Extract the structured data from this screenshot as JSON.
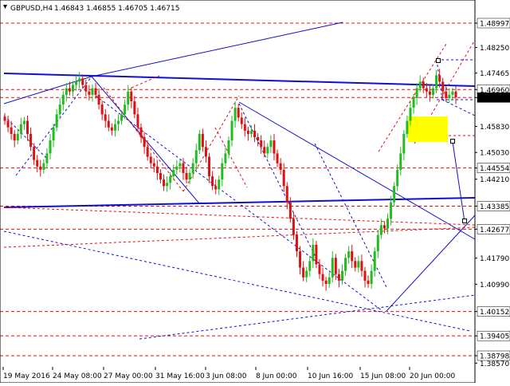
{
  "header": {
    "symbol": "GBPUSD,H4",
    "ohlc": "1.46843 1.46855 1.46705 1.46715"
  },
  "colors": {
    "background": "#ffffff",
    "bull": "#22bb22",
    "bear": "#dd1111",
    "red_line": "#e01010",
    "blue_line": "#1010cc",
    "highlight": "#ffff00"
  },
  "chart_data": {
    "type": "candlestick",
    "ylim": [
      1.3857,
      1.5023
    ],
    "y_ticks": [
      "1.48997",
      "1.48250",
      "1.47465",
      "1.46960",
      "1.46715",
      "1.45830",
      "1.45030",
      "1.44210",
      "1.44554",
      "1.43385",
      "1.42677",
      "1.41790",
      "1.40990",
      "1.40152",
      "1.39405",
      "1.38798",
      "1.38570"
    ],
    "x_ticks": [
      "19 May 2016",
      "24 May 08:00",
      "27 May 00:00",
      "31 May 16:00",
      "3 Jun 08:00",
      "8 Jun 00:00",
      "10 Jun 16:00",
      "15 Jun 08:00",
      "20 Jun 00:00"
    ],
    "marked_levels": [
      "1.48997",
      "1.46960",
      "1.46715",
      "1.44554",
      "1.43385",
      "1.42677",
      "1.40152",
      "1.39405",
      "1.38798"
    ],
    "close_series": [
      1.46,
      1.458,
      1.456,
      1.454,
      1.456,
      1.459,
      1.46,
      1.456,
      1.452,
      1.448,
      1.446,
      1.445,
      1.447,
      1.45,
      1.454,
      1.458,
      1.462,
      1.465,
      1.468,
      1.47,
      1.469,
      1.471,
      1.472,
      1.473,
      1.471,
      1.469,
      1.468,
      1.47,
      1.468,
      1.465,
      1.462,
      1.46,
      1.458,
      1.457,
      1.459,
      1.46,
      1.462,
      1.465,
      1.469,
      1.466,
      1.462,
      1.458,
      1.455,
      1.452,
      1.449,
      1.447,
      1.446,
      1.444,
      1.442,
      1.44,
      1.441,
      1.443,
      1.445,
      1.446,
      1.447,
      1.444,
      1.442,
      1.444,
      1.447,
      1.451,
      1.456,
      1.452,
      1.449,
      1.443,
      1.44,
      1.439,
      1.442,
      1.447,
      1.45,
      1.454,
      1.46,
      1.464,
      1.461,
      1.459,
      1.457,
      1.456,
      1.457,
      1.455,
      1.454,
      1.452,
      1.45,
      1.452,
      1.454,
      1.45,
      1.447,
      1.445,
      1.44,
      1.435,
      1.43,
      1.425,
      1.42,
      1.415,
      1.412,
      1.414,
      1.417,
      1.422,
      1.416,
      1.413,
      1.411,
      1.41,
      1.412,
      1.418,
      1.413,
      1.411,
      1.414,
      1.418,
      1.42,
      1.417,
      1.415,
      1.417,
      1.414,
      1.411,
      1.41,
      1.414,
      1.42,
      1.425,
      1.428,
      1.427,
      1.43,
      1.435,
      1.44,
      1.445,
      1.45,
      1.456,
      1.46,
      1.464,
      1.467,
      1.47,
      1.472,
      1.47,
      1.469,
      1.468,
      1.47,
      1.474,
      1.472,
      1.469,
      1.467,
      1.468,
      1.469,
      1.4672
    ]
  }
}
